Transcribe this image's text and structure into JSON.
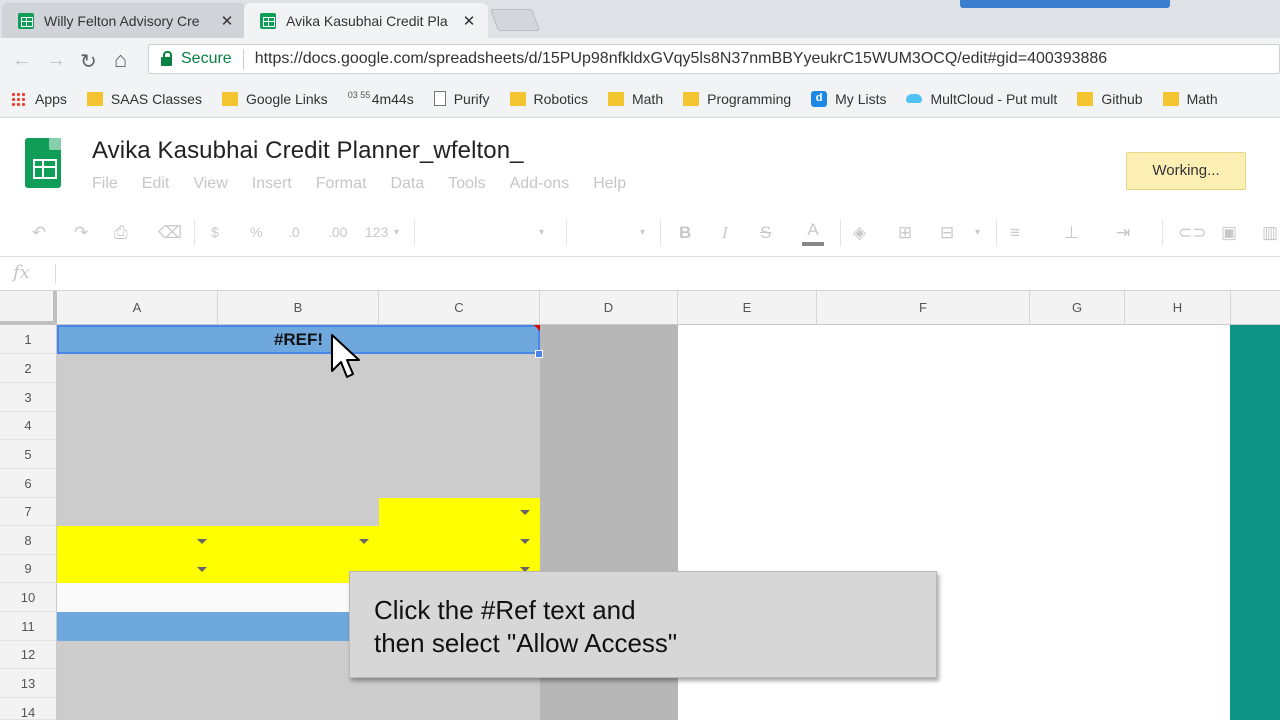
{
  "browser": {
    "tabs": [
      {
        "title": "Willy Felton Advisory Cre",
        "active": false
      },
      {
        "title": "Avika Kasubhai Credit Pla",
        "active": true
      }
    ],
    "tab_close": "✕",
    "secure_label": "Secure",
    "url": "https://docs.google.com/spreadsheets/d/15PUp98nfkldxGVqy5ls8N37nmBBYyeukrC15WUM3OCQ/edit#gid=400393886",
    "nav": {
      "back": "←",
      "forward": "→",
      "reload": "↻",
      "home": "⌂"
    }
  },
  "bookmarks": [
    {
      "label": "Apps",
      "icon": "apps-grid-icon"
    },
    {
      "label": "SAAS Classes",
      "icon": "folder-icon"
    },
    {
      "label": "Google Links",
      "icon": "folder-icon"
    },
    {
      "label": "4m44s",
      "icon": "counter-icon",
      "glyph": "03 55"
    },
    {
      "label": "Purify",
      "icon": "page-icon"
    },
    {
      "label": "Robotics",
      "icon": "folder-icon"
    },
    {
      "label": "Math",
      "icon": "folder-icon"
    },
    {
      "label": "Programming",
      "icon": "folder-icon"
    },
    {
      "label": "My Lists",
      "icon": "d-app-icon",
      "glyph": "d"
    },
    {
      "label": "MultCloud - Put mult",
      "icon": "cloud-icon"
    },
    {
      "label": "Github",
      "icon": "folder-icon"
    },
    {
      "label": "Math",
      "icon": "folder-icon"
    }
  ],
  "document": {
    "title": "Avika Kasubhai Credit Planner_wfelton_",
    "menu": [
      "File",
      "Edit",
      "View",
      "Insert",
      "Format",
      "Data",
      "Tools",
      "Add-ons",
      "Help"
    ],
    "status": "Working..."
  },
  "toolbar": {
    "currency": "$",
    "percent": "%",
    "decrease_decimal": ".0",
    "increase_decimal": ".00",
    "number_format": "123",
    "bold": "B",
    "italic": "I",
    "strikethrough": "S",
    "text_color": "A"
  },
  "formula_bar": {
    "fx": "fx",
    "value": ""
  },
  "grid": {
    "columns": [
      "A",
      "B",
      "C",
      "D",
      "E",
      "F",
      "G",
      "H"
    ],
    "rows": [
      "1",
      "2",
      "3",
      "4",
      "5",
      "6",
      "7",
      "8",
      "9",
      "10",
      "11",
      "12",
      "13",
      "14"
    ],
    "cell_b1": "#REF!"
  },
  "colors": {
    "sheets_green": "#0f9d58",
    "selection_blue": "#6fa8dc",
    "highlight_yellow": "#ffff00",
    "column_i_teal": "#0e9486",
    "status_yellow": "#fcefb4"
  },
  "caption": {
    "line1": "Click the #Ref text and",
    "line2": "then select \"Allow Access\""
  }
}
